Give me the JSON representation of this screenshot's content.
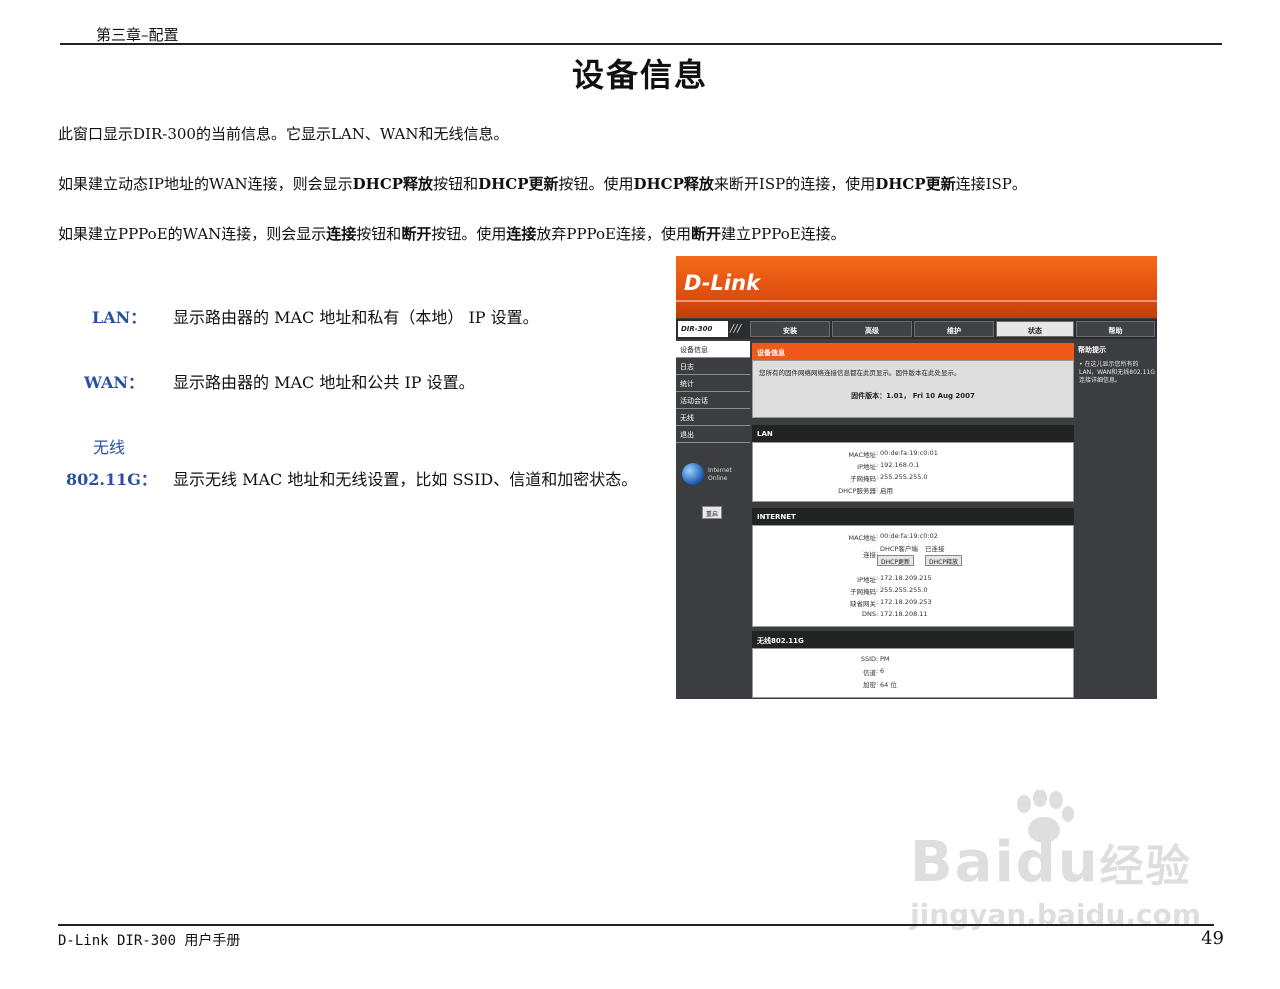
{
  "header": {
    "chapter": "第三章–配置",
    "title": "设备信息"
  },
  "paragraphs": {
    "p1": "此窗口显示DIR-300的当前信息。它显示LAN、WAN和无线信息。",
    "p2": [
      {
        "t": "如果建立动态IP地址的WAN连接，则会显示",
        "b": false
      },
      {
        "t": "DHCP释放",
        "b": true
      },
      {
        "t": "按钮和",
        "b": false
      },
      {
        "t": "DHCP更新",
        "b": true
      },
      {
        "t": "按钮。使用",
        "b": false
      },
      {
        "t": "DHCP释放",
        "b": true
      },
      {
        "t": "来断开ISP的连接，使用",
        "b": false
      },
      {
        "t": "DHCP更新",
        "b": true
      },
      {
        "t": "连接ISP。",
        "b": false
      }
    ],
    "p3": [
      {
        "t": "如果建立PPPoE的WAN连接，则会显示",
        "b": false
      },
      {
        "t": "连接",
        "b": true
      },
      {
        "t": "按钮和",
        "b": false
      },
      {
        "t": "断开",
        "b": true
      },
      {
        "t": "按钮。使用",
        "b": false
      },
      {
        "t": "连接",
        "b": true
      },
      {
        "t": "放弃PPPoE连接，使用",
        "b": false
      },
      {
        "t": "断开",
        "b": true
      },
      {
        "t": "建立PPPoE连接。",
        "b": false
      }
    ]
  },
  "definitions": [
    {
      "term": "LAN：",
      "desc": "显示路由器的 MAC 地址和私有（本地） IP 设置。"
    },
    {
      "term": "WAN：",
      "desc": "显示路由器的 MAC 地址和公共 IP 设置。"
    },
    {
      "term_line1": "无线",
      "term_line2": "802.11G：",
      "desc": "显示无线 MAC 地址和无线设置，比如 SSID、信道和加密状态。"
    }
  ],
  "footer": {
    "left": "D-Link DIR-300 用户手册",
    "page": "49"
  },
  "watermark": {
    "brand": "Bai",
    "brand2": "du",
    "brand3": "经验",
    "url": "jingyan.baidu.com"
  },
  "router": {
    "logo": "D-Link",
    "model": "DIR-300",
    "tabs": [
      "安装",
      "高级",
      "维护",
      "状态",
      "帮助"
    ],
    "active_tab": "状态",
    "left_menu": [
      "设备信息",
      "日志",
      "统计",
      "活动会话",
      "无线",
      "退出"
    ],
    "internet_status": [
      "Internet",
      "Online"
    ],
    "reboot_button": "重启",
    "info": {
      "title": "设备信息",
      "line": "您所有的固件网络网络连接信息都在此页显示。固件版本在此处显示。",
      "firmware": "固件版本：1.01， Fri 10 Aug 2007"
    },
    "lan": {
      "title": "LAN",
      "rows": [
        {
          "k": "MAC地址",
          "v": "00:de:fa:19:c0:01"
        },
        {
          "k": "IP地址",
          "v": "192.168.0.1"
        },
        {
          "k": "子网掩码",
          "v": "255.255.255.0"
        },
        {
          "k": "DHCP服务器",
          "v": "启用"
        }
      ]
    },
    "internet": {
      "title": "INTERNET",
      "mac": {
        "k": "MAC地址",
        "v": "00:de:fa:19:c0:02"
      },
      "conn": {
        "k": "连接",
        "v1": "DHCP客户端",
        "v2": "已连接",
        "btn_renew": "DHCP更新",
        "btn_release": "DHCP释放"
      },
      "rows": [
        {
          "k": "IP地址",
          "v": "172.18.209.215"
        },
        {
          "k": "子网掩码",
          "v": "255.255.255.0"
        },
        {
          "k": "缺省网关",
          "v": "172.18.209.253"
        },
        {
          "k": "DNS",
          "v": "172.18.208.11"
        }
      ]
    },
    "wireless": {
      "title": "无线802.11G",
      "rows": [
        {
          "k": "SSID",
          "v": "PM"
        },
        {
          "k": "信道",
          "v": "6"
        },
        {
          "k": "加密",
          "v": "64 位"
        }
      ]
    },
    "help": {
      "title": "帮助提示",
      "text": "• 在这儿显示您所有的LAN，WAN和无线802.11G连接详细信息。"
    }
  }
}
